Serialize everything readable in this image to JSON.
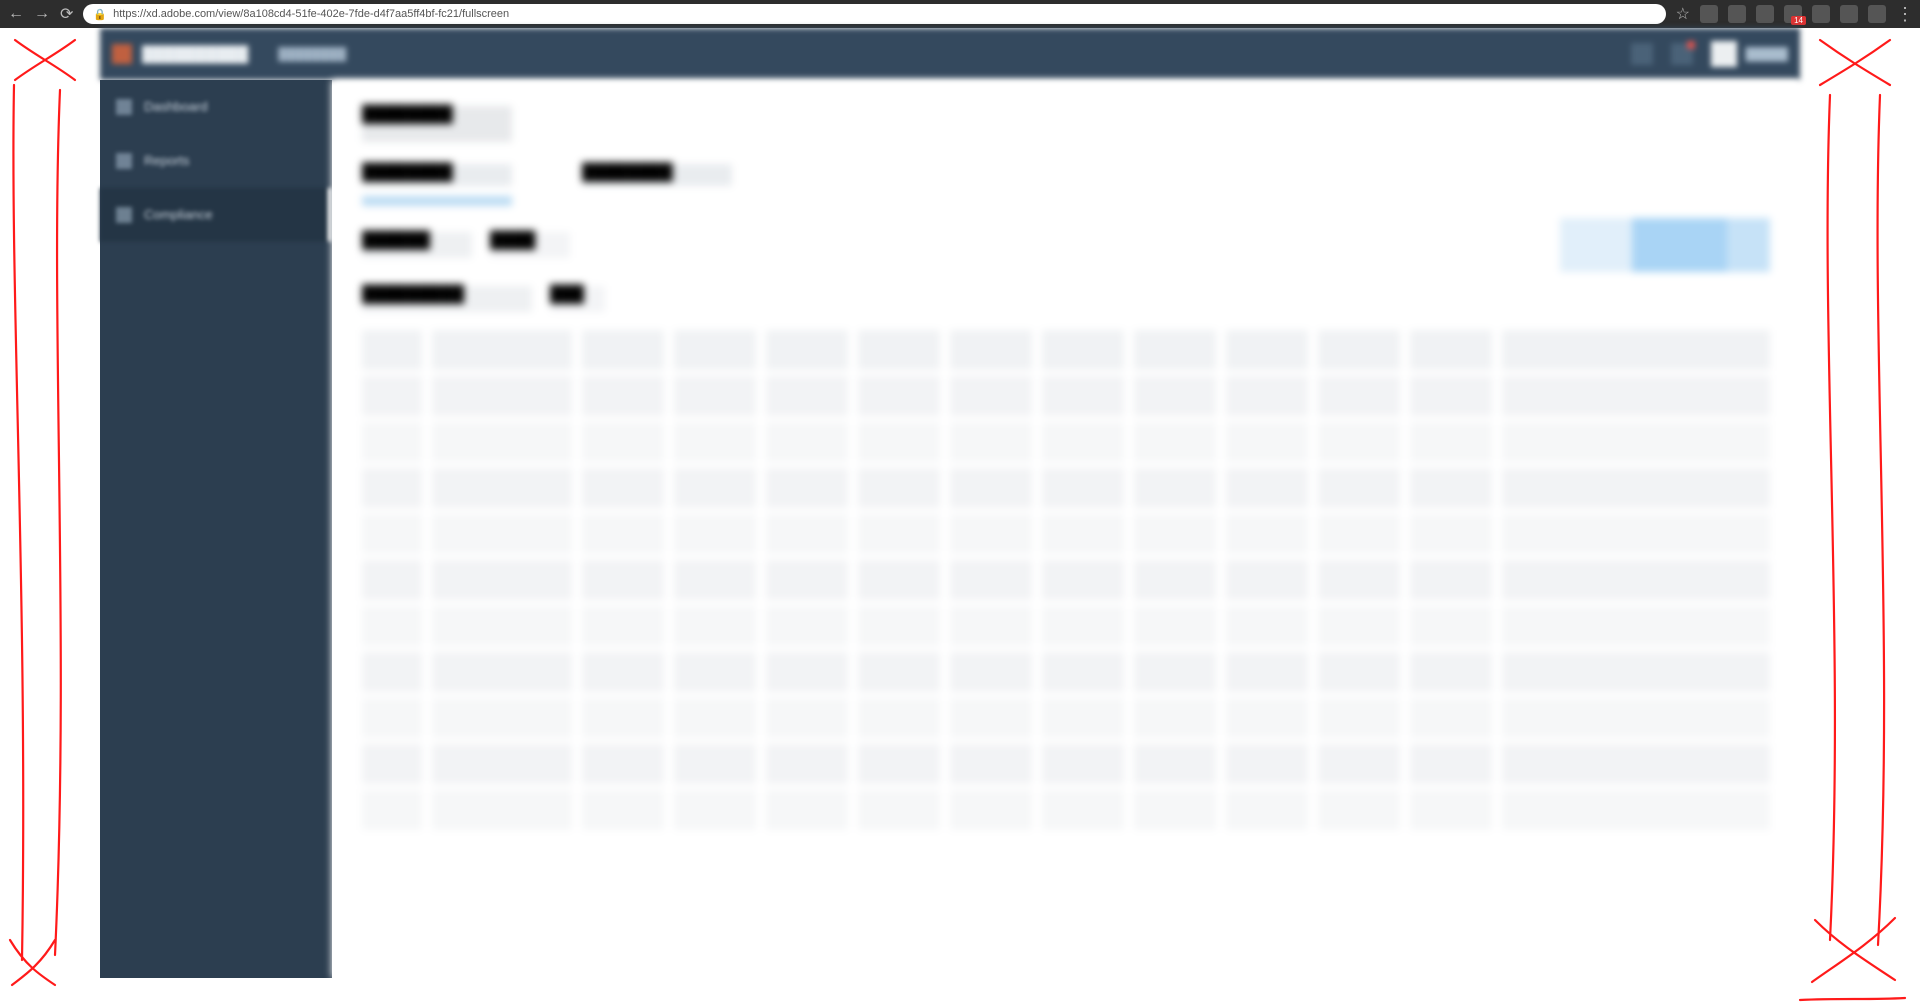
{
  "browser": {
    "url": "https://xd.adobe.com/view/8a108cd4-51fe-402e-7fde-d4f7aa5ff4bf-fc21/fullscreen",
    "back_icon": "←",
    "forward_icon": "→",
    "reload_icon": "⟳",
    "star_icon": "☆",
    "badge_count": "14",
    "menu_icon": "⋮"
  },
  "header": {
    "brand": "██████████",
    "sub": "████████",
    "username": "█████"
  },
  "sidebar": {
    "items": [
      {
        "label": "Dashboard"
      },
      {
        "label": "Reports"
      },
      {
        "label": "Compliance"
      }
    ],
    "active_index": 2
  },
  "main": {
    "page_title": "████████",
    "tabs": [
      {
        "label": "████████"
      },
      {
        "label": "████████"
      }
    ],
    "filter1_label": "██████",
    "filter1_value": "████",
    "filter2_label": "█████████",
    "filter2_value": "███",
    "apply_label": "█████",
    "columns": [
      "",
      "",
      "",
      "",
      "",
      "",
      "",
      "",
      "",
      "",
      "",
      "",
      "",
      ""
    ],
    "rows": 10
  },
  "annotation": {
    "note": "Red hand-drawn X marks and vertical lines on left and right margins indicating unused whitespace."
  }
}
